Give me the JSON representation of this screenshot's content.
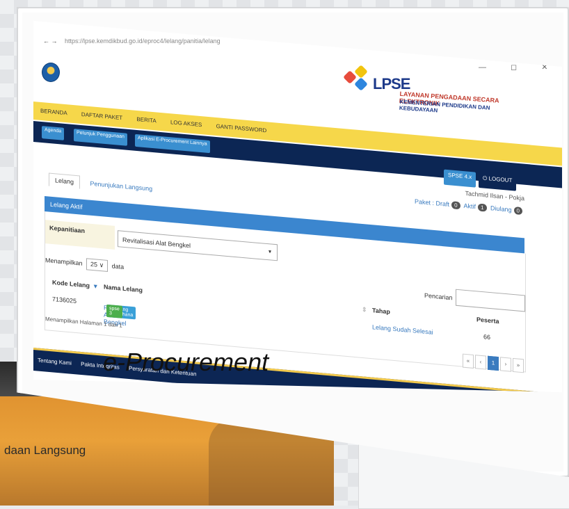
{
  "browser": {
    "nav_icons": "← →",
    "address": "https://lpse.kemdikbud.go.id/eproc4/lelang/panitia/lelang"
  },
  "brand": {
    "logo_text": "LPSE",
    "subtitle_1": "LAYANAN PENGADAAN SECARA ELEKTRONIK",
    "subtitle_2": "KEMENTERIAN PENDIDIKAN DAN KEBUDAYAAN"
  },
  "nav": {
    "items": [
      "BERANDA",
      "DAFTAR PAKET",
      "BERITA",
      "LOG AKSES",
      "GANTI PASSWORD"
    ]
  },
  "subnav": {
    "buttons": [
      "Agenda",
      "Petunjuk Penggunaan",
      "Aplikasi E-Procurement Lainnya"
    ],
    "right_buttons": [
      "SPSE 4.x",
      "LOGOUT"
    ]
  },
  "user": {
    "name": "Tachmid Ilsan - Pokja",
    "paket_label": "Paket :",
    "draft_label": "Draft",
    "draft_count": "0",
    "aktif_label": "Aktif",
    "aktif_count": "1",
    "diulang_label": "Diulang",
    "diulang_count": "0"
  },
  "tabs": [
    "Lelang",
    "Penunjukan Langsung"
  ],
  "section_title": "Lelang Aktif",
  "kepanitiaan": {
    "label": "Kepanitiaan",
    "selected": "Revitalisasi Alat Bengkel"
  },
  "table_controls": {
    "show_prefix": "Menampilkan",
    "show_value": "25",
    "show_suffix": "data",
    "search_label": "Pencarian"
  },
  "table": {
    "headers": [
      "Kode Lelang",
      "Nama Lelang",
      "Tahap",
      "Peserta"
    ],
    "rows": [
      {
        "kode": "7136025",
        "nama": "Revitalisasi Alat Bengkel",
        "badge1": "e-Lelang Sederhana",
        "badge2": "spse 3",
        "tahap": "Lelang Sudah Selesai",
        "peserta": "66"
      }
    ],
    "info": "Menampilkan Halaman 1 dari 1"
  },
  "pager": [
    "«",
    "‹",
    "1",
    "›",
    "»"
  ],
  "footer": {
    "links": [
      "Tentang Kami",
      "Pakta Integritas",
      "Persyaratan dan Ketentuan"
    ]
  },
  "caption": "e-Procurement",
  "background_slide": {
    "text": "daan Langsung"
  },
  "colors": {
    "nav_yellow": "#f6d74a",
    "navy": "#0c2654",
    "blue": "#3b86cf",
    "badge_blue": "#3aa0d8",
    "badge_green": "#4cae4c"
  }
}
